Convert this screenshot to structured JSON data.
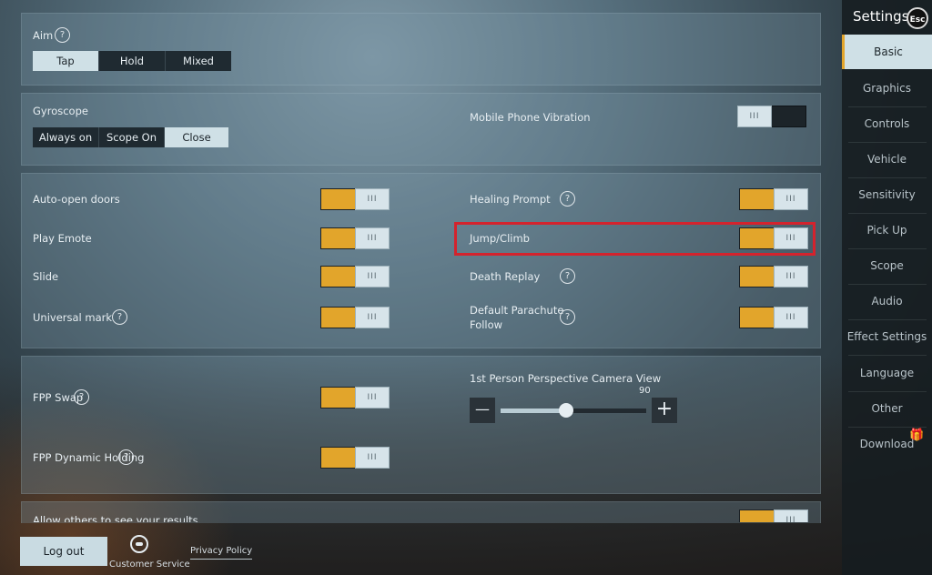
{
  "aim": {
    "label": "Aim",
    "help": "?",
    "options": [
      "Tap",
      "Hold",
      "Mixed"
    ],
    "selected": "Tap"
  },
  "gyroscope": {
    "label": "Gyroscope",
    "options": [
      "Always on",
      "Scope On",
      "Close"
    ],
    "selected": "Close"
  },
  "vibration": {
    "label": "Mobile Phone Vibration",
    "on": false
  },
  "toggles_left": [
    {
      "label": "Auto-open doors",
      "on": true
    },
    {
      "label": "Play Emote",
      "on": true
    },
    {
      "label": "Slide",
      "on": true
    },
    {
      "label": "Universal mark",
      "help": "?",
      "on": true
    }
  ],
  "toggles_right": [
    {
      "label": "Healing Prompt",
      "help": "?",
      "on": true
    },
    {
      "label": "Jump/Climb",
      "on": true
    },
    {
      "label": "Death Replay",
      "help": "?",
      "on": true
    },
    {
      "label": "Default Parachute Follow",
      "label_line1": "Default Parachute",
      "label_line2": "Follow",
      "help": "?",
      "on": true
    }
  ],
  "fpp": [
    {
      "label": "FPP Swap",
      "help": "?",
      "on": true
    },
    {
      "label": "FPP Dynamic Holding",
      "help": "?",
      "on": true
    }
  ],
  "camera_view": {
    "label": "1st Person Perspective Camera View",
    "value": "90",
    "fill_fraction": 0.45,
    "minus": "—",
    "plus": "+"
  },
  "allow_results": {
    "label": "Allow others to see your results",
    "on": true
  },
  "toggle_knob_glyph": "III",
  "sidebar": {
    "title": "Settings",
    "esc": "Esc",
    "gift_icon": "🎁",
    "items": [
      "Basic",
      "Graphics",
      "Controls",
      "Vehicle",
      "Sensitivity",
      "Pick Up",
      "Scope",
      "Audio",
      "Effect Settings",
      "Language",
      "Other",
      "Download"
    ],
    "active": "Basic"
  },
  "footer": {
    "logout": "Log out",
    "customer_service": "Customer Service",
    "privacy_policy": "Privacy Policy"
  },
  "colors": {
    "toggle_on": "#e2a52b",
    "highlight": "#d4232d",
    "active_bg": "#cfe0e6"
  }
}
